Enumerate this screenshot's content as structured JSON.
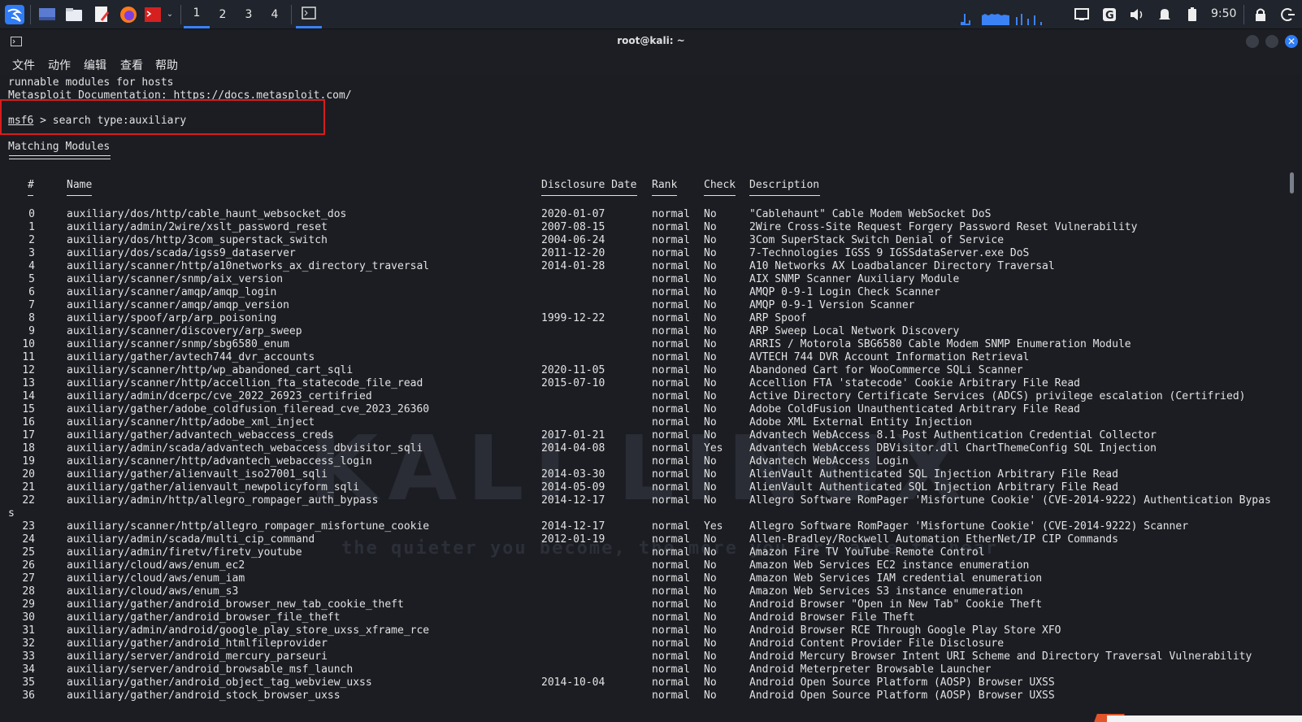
{
  "panel": {
    "workspaces": [
      "1",
      "2",
      "3",
      "4"
    ],
    "active_workspace": "1",
    "clock": "9:50",
    "icons": [
      "kali-menu-icon",
      "desktop-icon",
      "files-icon",
      "editor-icon",
      "firefox-icon",
      "terminal-launcher-icon",
      "dropdown-icon",
      "terminal-task-icon",
      "cpu-graph-icon",
      "network-graph-icon",
      "display-icon",
      "g-icon",
      "volume-icon",
      "bell-icon",
      "battery-icon",
      "lock-icon",
      "logout-icon"
    ]
  },
  "window": {
    "title": "root@kali: ~",
    "menu": [
      "文件",
      "动作",
      "编辑",
      "查看",
      "帮助"
    ]
  },
  "terminal": {
    "pre_lines": [
      "runnable modules for hosts",
      "Metasploit Documentation: https://docs.metasploit.com/"
    ],
    "prompt": "msf6",
    "command": " > search type:auxiliary",
    "section_title": "Matching Modules",
    "headers": {
      "idx": "#",
      "name": "Name",
      "date": "Disclosure Date",
      "rank": "Rank",
      "check": "Check",
      "desc": "Description"
    },
    "watermark": "KALI LINUX",
    "watermark_tagline": "the quieter you become, the more you are able to hear",
    "rows": [
      {
        "i": "0",
        "name": "auxiliary/dos/http/cable_haunt_websocket_dos",
        "date": "2020-01-07",
        "rank": "normal",
        "check": "No",
        "desc": "\"Cablehaunt\" Cable Modem WebSocket DoS"
      },
      {
        "i": "1",
        "name": "auxiliary/admin/2wire/xslt_password_reset",
        "date": "2007-08-15",
        "rank": "normal",
        "check": "No",
        "desc": "2Wire Cross-Site Request Forgery Password Reset Vulnerability"
      },
      {
        "i": "2",
        "name": "auxiliary/dos/http/3com_superstack_switch",
        "date": "2004-06-24",
        "rank": "normal",
        "check": "No",
        "desc": "3Com SuperStack Switch Denial of Service"
      },
      {
        "i": "3",
        "name": "auxiliary/dos/scada/igss9_dataserver",
        "date": "2011-12-20",
        "rank": "normal",
        "check": "No",
        "desc": "7-Technologies IGSS 9 IGSSdataServer.exe DoS"
      },
      {
        "i": "4",
        "name": "auxiliary/scanner/http/a10networks_ax_directory_traversal",
        "date": "2014-01-28",
        "rank": "normal",
        "check": "No",
        "desc": "A10 Networks AX Loadbalancer Directory Traversal"
      },
      {
        "i": "5",
        "name": "auxiliary/scanner/snmp/aix_version",
        "date": "",
        "rank": "normal",
        "check": "No",
        "desc": "AIX SNMP Scanner Auxiliary Module"
      },
      {
        "i": "6",
        "name": "auxiliary/scanner/amqp/amqp_login",
        "date": "",
        "rank": "normal",
        "check": "No",
        "desc": "AMQP 0-9-1 Login Check Scanner"
      },
      {
        "i": "7",
        "name": "auxiliary/scanner/amqp/amqp_version",
        "date": "",
        "rank": "normal",
        "check": "No",
        "desc": "AMQP 0-9-1 Version Scanner"
      },
      {
        "i": "8",
        "name": "auxiliary/spoof/arp/arp_poisoning",
        "date": "1999-12-22",
        "rank": "normal",
        "check": "No",
        "desc": "ARP Spoof"
      },
      {
        "i": "9",
        "name": "auxiliary/scanner/discovery/arp_sweep",
        "date": "",
        "rank": "normal",
        "check": "No",
        "desc": "ARP Sweep Local Network Discovery"
      },
      {
        "i": "10",
        "name": "auxiliary/scanner/snmp/sbg6580_enum",
        "date": "",
        "rank": "normal",
        "check": "No",
        "desc": "ARRIS / Motorola SBG6580 Cable Modem SNMP Enumeration Module"
      },
      {
        "i": "11",
        "name": "auxiliary/gather/avtech744_dvr_accounts",
        "date": "",
        "rank": "normal",
        "check": "No",
        "desc": "AVTECH 744 DVR Account Information Retrieval"
      },
      {
        "i": "12",
        "name": "auxiliary/scanner/http/wp_abandoned_cart_sqli",
        "date": "2020-11-05",
        "rank": "normal",
        "check": "No",
        "desc": "Abandoned Cart for WooCommerce SQLi Scanner"
      },
      {
        "i": "13",
        "name": "auxiliary/scanner/http/accellion_fta_statecode_file_read",
        "date": "2015-07-10",
        "rank": "normal",
        "check": "No",
        "desc": "Accellion FTA 'statecode' Cookie Arbitrary File Read"
      },
      {
        "i": "14",
        "name": "auxiliary/admin/dcerpc/cve_2022_26923_certifried",
        "date": "",
        "rank": "normal",
        "check": "No",
        "desc": "Active Directory Certificate Services (ADCS) privilege escalation (Certifried)"
      },
      {
        "i": "15",
        "name": "auxiliary/gather/adobe_coldfusion_fileread_cve_2023_26360",
        "date": "",
        "rank": "normal",
        "check": "No",
        "desc": "Adobe ColdFusion Unauthenticated Arbitrary File Read"
      },
      {
        "i": "16",
        "name": "auxiliary/scanner/http/adobe_xml_inject",
        "date": "",
        "rank": "normal",
        "check": "No",
        "desc": "Adobe XML External Entity Injection"
      },
      {
        "i": "17",
        "name": "auxiliary/gather/advantech_webaccess_creds",
        "date": "2017-01-21",
        "rank": "normal",
        "check": "No",
        "desc": "Advantech WebAccess 8.1 Post Authentication Credential Collector"
      },
      {
        "i": "18",
        "name": "auxiliary/admin/scada/advantech_webaccess_dbvisitor_sqli",
        "date": "2014-04-08",
        "rank": "normal",
        "check": "Yes",
        "desc": "Advantech WebAccess DBVisitor.dll ChartThemeConfig SQL Injection"
      },
      {
        "i": "19",
        "name": "auxiliary/scanner/http/advantech_webaccess_login",
        "date": "",
        "rank": "normal",
        "check": "No",
        "desc": "Advantech WebAccess Login"
      },
      {
        "i": "20",
        "name": "auxiliary/gather/alienvault_iso27001_sqli",
        "date": "2014-03-30",
        "rank": "normal",
        "check": "No",
        "desc": "AlienVault Authenticated SQL Injection Arbitrary File Read"
      },
      {
        "i": "21",
        "name": "auxiliary/gather/alienvault_newpolicyform_sqli",
        "date": "2014-05-09",
        "rank": "normal",
        "check": "No",
        "desc": "AlienVault Authenticated SQL Injection Arbitrary File Read"
      },
      {
        "i": "22",
        "name": "auxiliary/admin/http/allegro_rompager_auth_bypass",
        "date": "2014-12-17",
        "rank": "normal",
        "check": "No",
        "desc": "Allegro Software RomPager 'Misfortune Cookie' (CVE-2014-9222) Authentication Bypas"
      },
      {
        "i": "",
        "name": "",
        "date": "",
        "rank": "",
        "check": "",
        "desc": "",
        "wrap": "s"
      },
      {
        "i": "23",
        "name": "auxiliary/scanner/http/allegro_rompager_misfortune_cookie",
        "date": "2014-12-17",
        "rank": "normal",
        "check": "Yes",
        "desc": "Allegro Software RomPager 'Misfortune Cookie' (CVE-2014-9222) Scanner"
      },
      {
        "i": "24",
        "name": "auxiliary/admin/scada/multi_cip_command",
        "date": "2012-01-19",
        "rank": "normal",
        "check": "No",
        "desc": "Allen-Bradley/Rockwell Automation EtherNet/IP CIP Commands"
      },
      {
        "i": "25",
        "name": "auxiliary/admin/firetv/firetv_youtube",
        "date": "",
        "rank": "normal",
        "check": "No",
        "desc": "Amazon Fire TV YouTube Remote Control"
      },
      {
        "i": "26",
        "name": "auxiliary/cloud/aws/enum_ec2",
        "date": "",
        "rank": "normal",
        "check": "No",
        "desc": "Amazon Web Services EC2 instance enumeration"
      },
      {
        "i": "27",
        "name": "auxiliary/cloud/aws/enum_iam",
        "date": "",
        "rank": "normal",
        "check": "No",
        "desc": "Amazon Web Services IAM credential enumeration"
      },
      {
        "i": "28",
        "name": "auxiliary/cloud/aws/enum_s3",
        "date": "",
        "rank": "normal",
        "check": "No",
        "desc": "Amazon Web Services S3 instance enumeration"
      },
      {
        "i": "29",
        "name": "auxiliary/gather/android_browser_new_tab_cookie_theft",
        "date": "",
        "rank": "normal",
        "check": "No",
        "desc": "Android Browser \"Open in New Tab\" Cookie Theft"
      },
      {
        "i": "30",
        "name": "auxiliary/gather/android_browser_file_theft",
        "date": "",
        "rank": "normal",
        "check": "No",
        "desc": "Android Browser File Theft"
      },
      {
        "i": "31",
        "name": "auxiliary/admin/android/google_play_store_uxss_xframe_rce",
        "date": "",
        "rank": "normal",
        "check": "No",
        "desc": "Android Browser RCE Through Google Play Store XFO"
      },
      {
        "i": "32",
        "name": "auxiliary/gather/android_htmlfileprovider",
        "date": "",
        "rank": "normal",
        "check": "No",
        "desc": "Android Content Provider File Disclosure"
      },
      {
        "i": "33",
        "name": "auxiliary/server/android_mercury_parseuri",
        "date": "",
        "rank": "normal",
        "check": "No",
        "desc": "Android Mercury Browser Intent URI Scheme and Directory Traversal Vulnerability"
      },
      {
        "i": "34",
        "name": "auxiliary/server/android_browsable_msf_launch",
        "date": "",
        "rank": "normal",
        "check": "No",
        "desc": "Android Meterpreter Browsable Launcher"
      },
      {
        "i": "35",
        "name": "auxiliary/gather/android_object_tag_webview_uxss",
        "date": "2014-10-04",
        "rank": "normal",
        "check": "No",
        "desc": "Android Open Source Platform (AOSP) Browser UXSS"
      },
      {
        "i": "36",
        "name": "auxiliary/gather/android_stock_browser_uxss",
        "date": "",
        "rank": "normal",
        "check": "No",
        "desc": "Android Open Source Platform (AOSP) Browser UXSS"
      }
    ]
  },
  "colors": {
    "panel_bg": "#20242c",
    "terminal_bg": "#1b1d23",
    "text": "#e2e2e2",
    "accent": "#2f7cf6",
    "highlight_box": "#d71d1d"
  }
}
